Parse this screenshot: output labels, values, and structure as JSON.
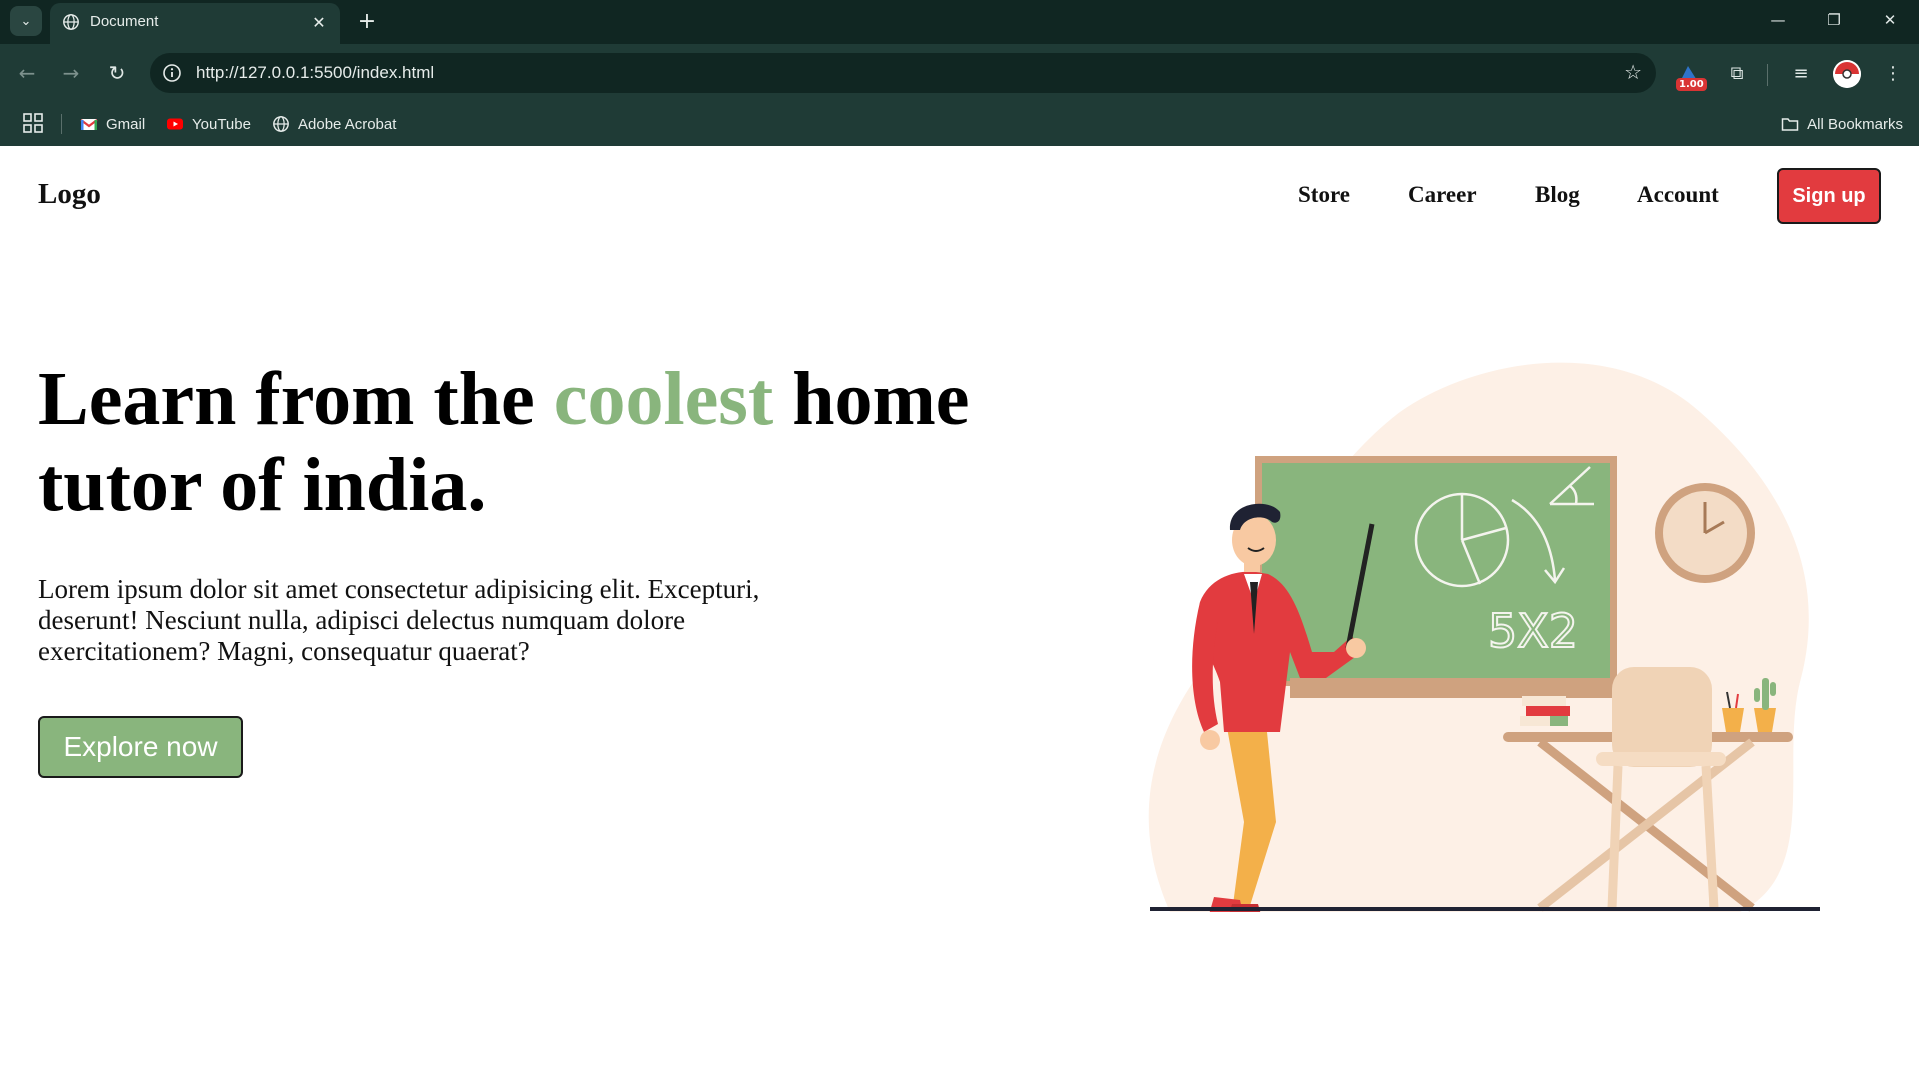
{
  "browser": {
    "tab_title": "Document",
    "url": "http://127.0.0.1:5500/index.html",
    "extension_badge": "1.00",
    "bookmarks": [
      {
        "label": "Gmail",
        "icon": "gmail-icon"
      },
      {
        "label": "YouTube",
        "icon": "youtube-icon"
      },
      {
        "label": "Adobe Acrobat",
        "icon": "globe-icon"
      }
    ],
    "all_bookmarks_label": "All Bookmarks"
  },
  "header": {
    "logo": "Logo",
    "nav": [
      "Store",
      "Career",
      "Blog",
      "Account"
    ],
    "signup_label": "Sign up"
  },
  "hero": {
    "headline_before": "Learn from the ",
    "headline_accent": "coolest",
    "headline_after": " home tutor of india.",
    "lead": "Lorem ipsum dolor sit amet consectetur adipisicing elit. Excepturi, deserunt! Nesciunt nulla, adipisci delectus numquam dolore exercitationem? Magni, consequatur quaerat?",
    "cta_label": "Explore now",
    "board_text": "5X2"
  },
  "colors": {
    "chrome_bg": "#1f3b36",
    "tabstrip_bg": "#102622",
    "accent_green": "#89b57d",
    "signup_red": "#e23b3f",
    "blob": "#fdf0e6"
  }
}
